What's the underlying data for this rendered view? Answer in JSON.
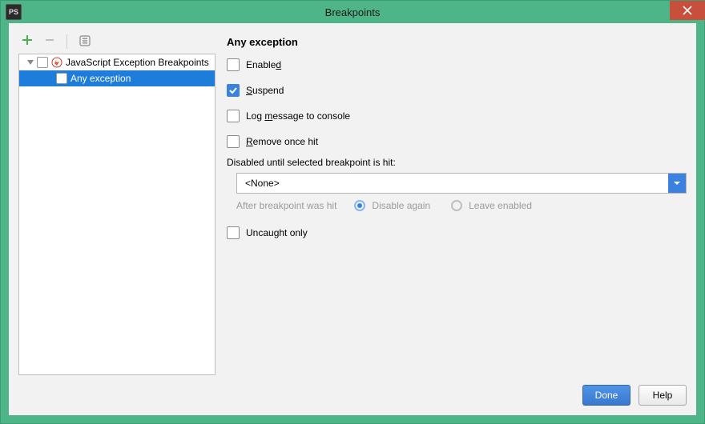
{
  "window": {
    "app_icon_text": "PS",
    "title": "Breakpoints"
  },
  "toolbar": {
    "add": "+",
    "remove": "−",
    "group": "group"
  },
  "tree": {
    "category": {
      "label": "JavaScript Exception Breakpoints",
      "checked": false
    },
    "item": {
      "label": "Any exception",
      "checked": false,
      "selected": true
    }
  },
  "panel": {
    "heading": "Any exception",
    "enabled": {
      "label_pre": "Enable",
      "mn": "d",
      "label_post": "",
      "checked": false
    },
    "suspend": {
      "label_pre": "",
      "mn": "S",
      "label_post": "uspend",
      "checked": true
    },
    "log": {
      "label_pre": "Log ",
      "mn": "m",
      "label_post": "essage to console",
      "checked": false
    },
    "remove_once": {
      "label_pre": "",
      "mn": "R",
      "label_post": "emove once hit",
      "checked": false
    },
    "disabled_until_label": "Disabled until selected breakpoint is hit:",
    "combo_value": "<None>",
    "after_hit_label": "After breakpoint was hit",
    "radio_disable_again": "Disable again",
    "radio_leave_enabled": "Leave enabled",
    "uncaught_only": {
      "label": "Uncaught only",
      "checked": false
    }
  },
  "buttons": {
    "done": "Done",
    "help": "Help"
  }
}
